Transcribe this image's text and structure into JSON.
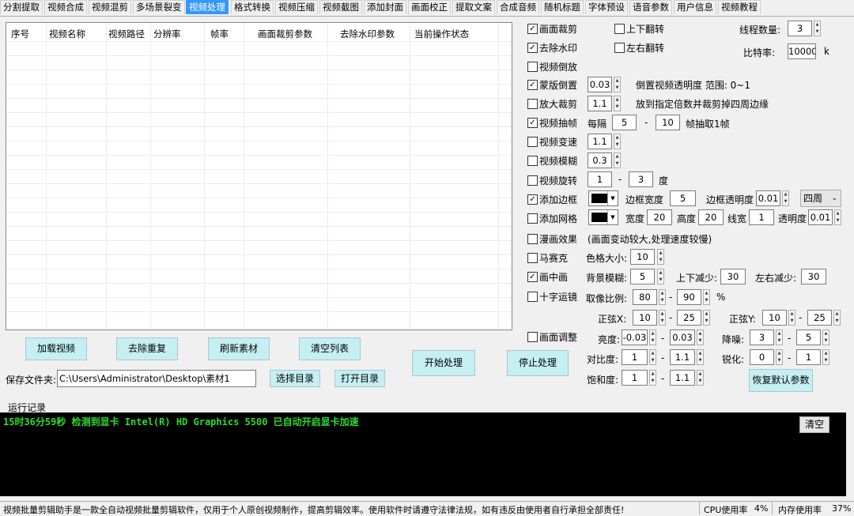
{
  "tabs": [
    {
      "label": "分割提取"
    },
    {
      "label": "视频合成"
    },
    {
      "label": "视频混剪"
    },
    {
      "label": "多场景裂变"
    },
    {
      "label": "视频处理"
    },
    {
      "label": "格式转换"
    },
    {
      "label": "视频压缩"
    },
    {
      "label": "视频截图"
    },
    {
      "label": "添加封面"
    },
    {
      "label": "画面校正"
    },
    {
      "label": "提取文案"
    },
    {
      "label": "合成音频"
    },
    {
      "label": "随机标题"
    },
    {
      "label": "字体预设"
    },
    {
      "label": "语音参数"
    },
    {
      "label": "用户信息"
    },
    {
      "label": "视频教程"
    }
  ],
  "table": {
    "columns": [
      "序号",
      "视频名称",
      "视频路径",
      "分辨率",
      "帧率",
      "画面裁剪参数",
      "去除水印参数",
      "当前操作状态"
    ]
  },
  "buttons": {
    "load": "加载视频",
    "dedupe": "去除重复",
    "refresh": "刷新素材",
    "clear_list": "清空列表",
    "start": "开始处理",
    "stop": "停止处理",
    "choose_dir": "选择目录",
    "open_dir": "打开目录",
    "restore": "恢复默认参数",
    "clear_log": "清空"
  },
  "save": {
    "label": "保存文件夹:",
    "path": "C:\\Users\\Administrator\\Desktop\\素材1"
  },
  "opts": {
    "crop": {
      "label": "画面裁剪",
      "checked": true
    },
    "flip_v": {
      "label": "上下翻转",
      "checked": false
    },
    "threads_label": "线程数量:",
    "threads": "3",
    "remove_wm": {
      "label": "去除水印",
      "checked": true
    },
    "flip_h": {
      "label": "左右翻转",
      "checked": false
    },
    "bitrate_label": "比特率:",
    "bitrate": "10000",
    "bitrate_unit": "k",
    "reverse": {
      "label": "视频倒放",
      "checked": false
    },
    "mask": {
      "label": "蒙版倒置",
      "checked": true,
      "value": "0.03",
      "note": "倒置视频透明度 范围: 0~1"
    },
    "zoom": {
      "label": "放大裁剪",
      "checked": false,
      "value": "1.1",
      "note": "放到指定倍数并裁剪掉四周边缘"
    },
    "frame": {
      "label": "视频抽帧",
      "checked": true,
      "every": "每隔",
      "from": "5",
      "dash": "-",
      "to": "10",
      "note": "帧抽取1帧"
    },
    "speed": {
      "label": "视频变速",
      "checked": false,
      "value": "1.1"
    },
    "blur": {
      "label": "视频模糊",
      "checked": false,
      "value": "0.3"
    },
    "rotate": {
      "label": "视频旋转",
      "checked": false,
      "from": "1",
      "dash": "-",
      "to": "3",
      "unit": "度"
    },
    "border": {
      "label": "添加边框",
      "checked": true,
      "width_label": "边框宽度",
      "width": "5",
      "alpha_label": "边框透明度",
      "alpha": "0.01",
      "side": "四周"
    },
    "grid": {
      "label": "添加网格",
      "checked": false,
      "w_label": "宽度",
      "w": "20",
      "h_label": "高度",
      "h": "20",
      "line_label": "线宽",
      "line": "1",
      "alpha_label": "透明度",
      "alpha": "0.01"
    },
    "comic": {
      "label": "漫画效果",
      "checked": false,
      "note": "(画面变动较大,处理速度较慢)"
    },
    "mosaic": {
      "label": "马赛克",
      "checked": false,
      "size_label": "色格大小:",
      "size": "10"
    },
    "pip": {
      "label": "画中画",
      "checked": true,
      "bg_label": "背景模糊:",
      "bg": "5",
      "tb_label": "上下减少:",
      "tb": "30",
      "lr_label": "左右减少:",
      "lr": "30"
    },
    "cross": {
      "label": "十字运镜",
      "checked": false,
      "ratio_label": "取像比例:",
      "r1": "80",
      "dash": "-",
      "r2": "90",
      "pct": "%",
      "sx_label": "正弦X:",
      "sx1": "10",
      "sx2": "25",
      "sy_label": "正弦Y:",
      "sy1": "10",
      "sy2": "25"
    },
    "adjust": {
      "label": "画面调整",
      "checked": false,
      "bright_label": "亮度:",
      "b1": "-0.03",
      "b2": "0.03",
      "contrast_label": "对比度:",
      "c1": "1",
      "c2": "1.1",
      "sat_label": "饱和度:",
      "s1": "1",
      "s2": "1.1",
      "denoise_label": "降噪:",
      "d1": "3",
      "d2": "5",
      "sharp_label": "锐化:",
      "sh1": "0",
      "sh2": "1",
      "dash": "-"
    }
  },
  "log": {
    "title": "运行记录",
    "line": "15时36分59秒 检测到显卡 Intel(R) HD Graphics 5500 已自动开启显卡加速"
  },
  "status": {
    "text": "视频批量剪辑助手是一款全自动视频批量剪辑软件，仅用于个人原创视频制作，提高剪辑效率。使用软件时请遵守法律法规，如有违反由使用者自行承担全部责任!",
    "cpu_label": "CPU使用率",
    "cpu": "4%",
    "mem_label": "内存使用率",
    "mem": "37%"
  },
  "colors": {
    "accent_tab": "#3399ff",
    "button_bg": "#c5eff2",
    "log_text": "#2ddc2d",
    "log_bg": "#000000"
  }
}
